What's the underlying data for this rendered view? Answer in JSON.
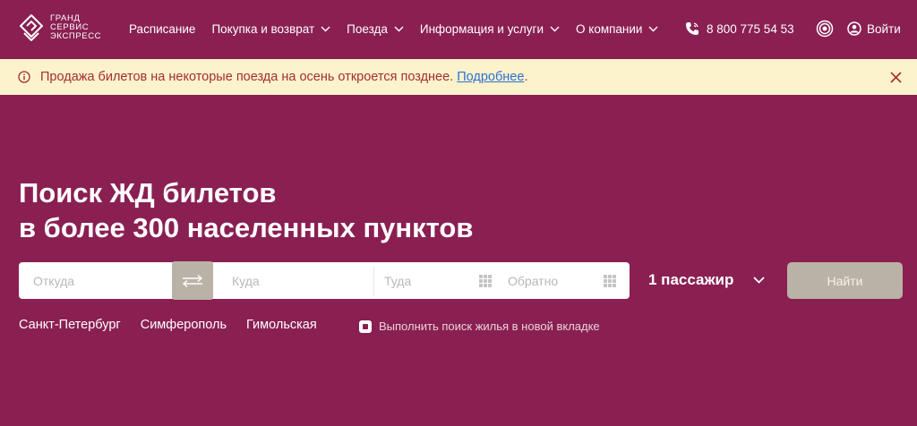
{
  "header": {
    "logo_lines": [
      "ГРАНД",
      "СЕРВИС",
      "ЭКСПРЕСС"
    ],
    "nav": [
      {
        "label": "Расписание",
        "has_dropdown": false
      },
      {
        "label": "Покупка и возврат",
        "has_dropdown": true
      },
      {
        "label": "Поезда",
        "has_dropdown": true
      },
      {
        "label": "Информация и услуги",
        "has_dropdown": true
      },
      {
        "label": "О компании",
        "has_dropdown": true
      }
    ],
    "phone": "8 800 775 54 53",
    "login": "Войти"
  },
  "notice": {
    "text": "Продажа билетов на некоторые поезда на осень откроется позднее.",
    "link": "Подробнее",
    "after_link": ".",
    "bg_color": "#fcf3cc",
    "text_color": "#a42e2e"
  },
  "hero": {
    "title_line1": "Поиск ЖД билетов",
    "title_line2": "в более 300 населенных пунктов"
  },
  "search": {
    "from_placeholder": "Откуда",
    "to_placeholder": "Куда",
    "date_there_placeholder": "Туда",
    "date_back_placeholder": "Обратно",
    "passengers": "1 пассажир",
    "find_button": "Найти"
  },
  "quick_links": [
    "Санкт-Петербург",
    "Симферополь",
    "Гимольская"
  ],
  "housing_checkbox": {
    "label": "Выполнить поиск жилья в новой вкладке",
    "checked": true
  },
  "colors": {
    "background": "#8a1f52",
    "button": "#bab2a6"
  }
}
